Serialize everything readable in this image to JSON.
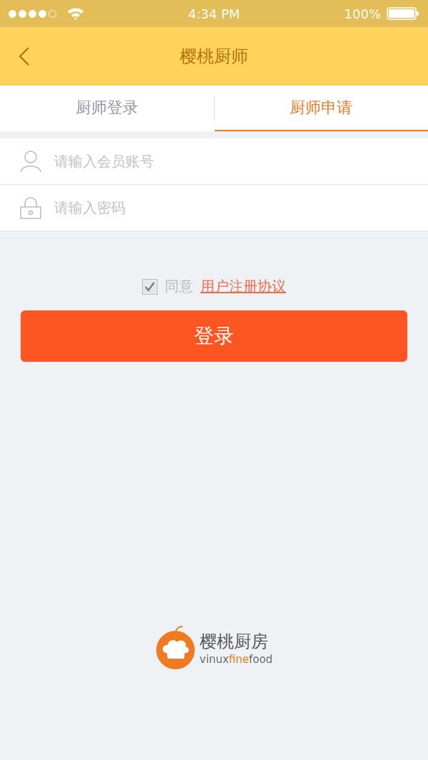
{
  "status_bar": {
    "signal_dots": [
      {
        "on": true
      },
      {
        "on": true
      },
      {
        "on": true
      },
      {
        "on": true
      },
      {
        "on": false
      }
    ],
    "time": "4:34 PM",
    "battery": "100%"
  },
  "nav": {
    "title": "樱桃厨师"
  },
  "tabs": [
    {
      "label": "厨师登录",
      "selected": false
    },
    {
      "label": "厨师申请",
      "selected": true
    }
  ],
  "fields": [
    {
      "kind": "user",
      "placeholder": "请输入会员账号"
    },
    {
      "kind": "lock",
      "placeholder": "请输入密码"
    }
  ],
  "agreement": {
    "checked": true,
    "text": "同意",
    "link": "用户注册协议"
  },
  "login_button": "登录",
  "logo": {
    "name": "樱桃厨房",
    "subtitle": [
      {
        "text": "vinux",
        "highlight": false
      },
      {
        "text": "fine",
        "highlight": true
      },
      {
        "text": "food",
        "highlight": false
      }
    ]
  }
}
